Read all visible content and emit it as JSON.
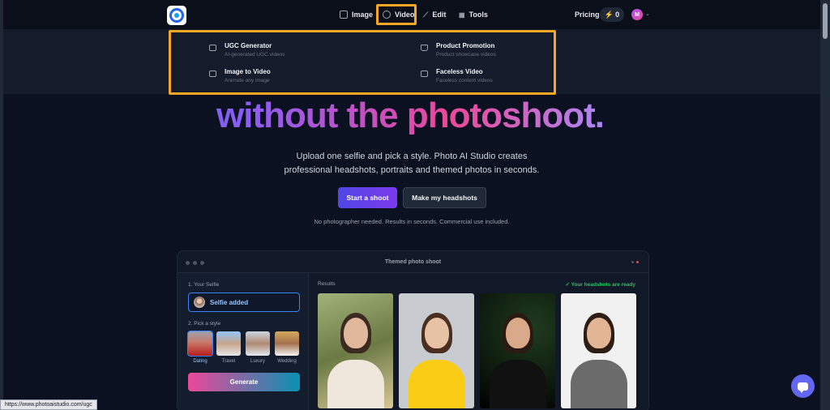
{
  "nav": {
    "items": [
      {
        "label": "Image",
        "icon": "image-icon"
      },
      {
        "label": "Video",
        "icon": "video-icon"
      },
      {
        "label": "Edit",
        "icon": "wand-icon"
      },
      {
        "label": "Tools",
        "icon": "grid-icon"
      }
    ],
    "pricing_label": "Pricing",
    "credits": "0",
    "avatar_initial": "M",
    "highlight_color": "#f5a623"
  },
  "video_menu": {
    "items": [
      {
        "title": "UGC Generator",
        "subtitle": "AI-generated UGC videos",
        "icon": "video-icon"
      },
      {
        "title": "Product Promotion",
        "subtitle": "Product showcase videos",
        "icon": "bag-icon"
      },
      {
        "title": "Image to Video",
        "subtitle": "Animate any image",
        "icon": "video-icon"
      },
      {
        "title": "Faceless Video",
        "subtitle": "Faceless content videos",
        "icon": "video-icon"
      }
    ]
  },
  "hero": {
    "headline": "without the photoshoot.",
    "subtitle_line1": "Upload one selfie and pick a style. Photo AI Studio creates",
    "subtitle_line2": "professional headshots, portraits and themed photos in seconds.",
    "primary_cta": "Start a shoot",
    "secondary_cta": "Make my headshots",
    "note": "No photographer needed. Results in seconds. Commercial use included."
  },
  "demo": {
    "title": "Themed photo shoot",
    "step1_label": "1. Your Selfie",
    "selfie_status": "Selfie added",
    "step2_label": "2. Pick a style",
    "styles": [
      "Dating",
      "Travel",
      "Luxury",
      "Wedding"
    ],
    "selected_style": "Dating",
    "generate_label": "Generate",
    "results_label": "Results",
    "ready_text": "✓ Your headshots are ready"
  },
  "status_url": "https://www.photoaistudio.com/ugc"
}
